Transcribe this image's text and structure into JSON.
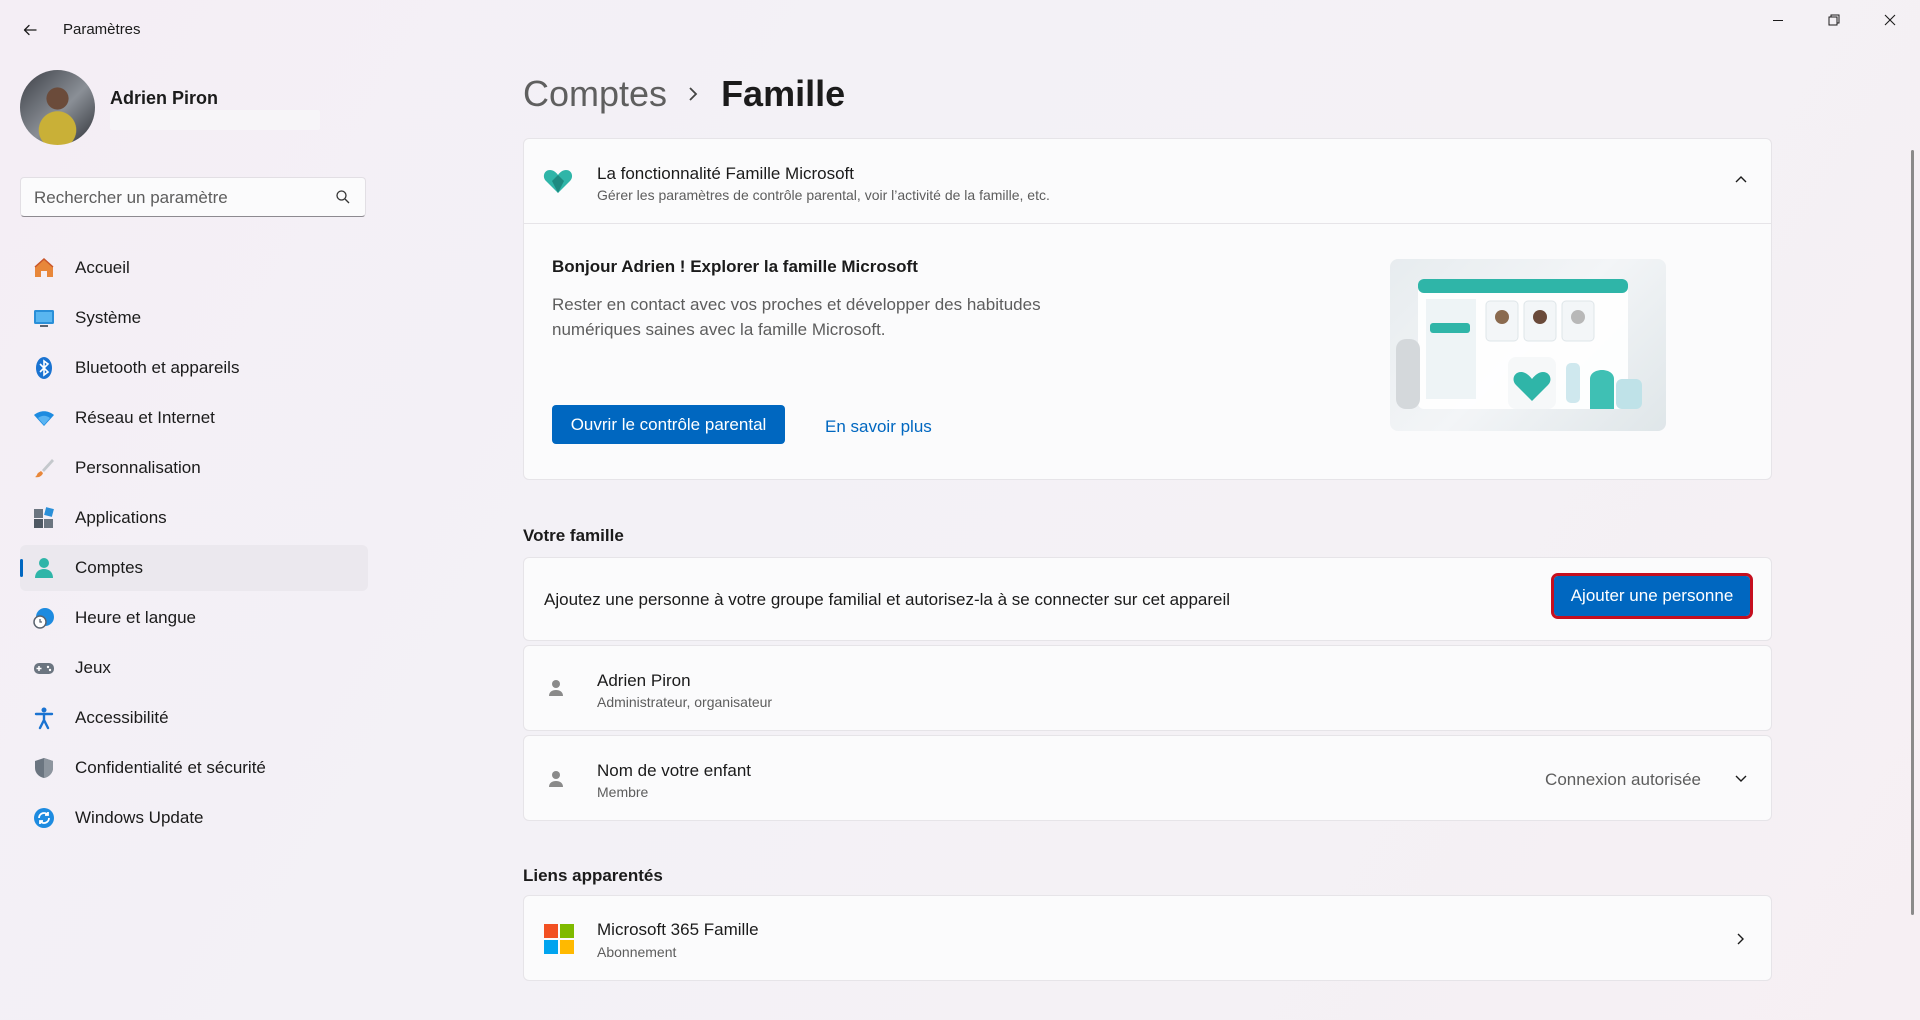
{
  "window": {
    "title": "Paramètres"
  },
  "profile": {
    "name": "Adrien Piron"
  },
  "search": {
    "placeholder": "Rechercher un paramètre"
  },
  "sidebar": {
    "items": [
      {
        "label": "Accueil",
        "icon": "home-icon"
      },
      {
        "label": "Système",
        "icon": "display-icon"
      },
      {
        "label": "Bluetooth et appareils",
        "icon": "bluetooth-icon"
      },
      {
        "label": "Réseau et Internet",
        "icon": "wifi-icon"
      },
      {
        "label": "Personnalisation",
        "icon": "brush-icon"
      },
      {
        "label": "Applications",
        "icon": "apps-icon"
      },
      {
        "label": "Comptes",
        "icon": "person-icon",
        "active": true
      },
      {
        "label": "Heure et langue",
        "icon": "globe-clock-icon"
      },
      {
        "label": "Jeux",
        "icon": "gamepad-icon"
      },
      {
        "label": "Accessibilité",
        "icon": "accessibility-icon"
      },
      {
        "label": "Confidentialité et sécurité",
        "icon": "shield-icon"
      },
      {
        "label": "Windows Update",
        "icon": "update-icon"
      }
    ]
  },
  "breadcrumb": {
    "parent": "Comptes",
    "current": "Famille"
  },
  "family_feature": {
    "title": "La fonctionnalité Famille Microsoft",
    "subtitle": "Gérer les paramètres de contrôle parental, voir l’activité de la famille, etc.",
    "hello": "Bonjour Adrien ! Explorer la famille Microsoft",
    "description": "Rester en contact avec vos proches et développer des habitudes numériques saines avec la famille Microsoft.",
    "primary_button": "Ouvrir le contrôle parental",
    "link": "En savoir plus"
  },
  "your_family": {
    "title": "Votre famille",
    "add_text": "Ajoutez une personne à votre groupe familial et autorisez-la à se connecter sur cet appareil",
    "add_button": "Ajouter une personne",
    "members": [
      {
        "name": "Adrien Piron",
        "role": "Administrateur, organisateur"
      },
      {
        "name": "Nom de votre enfant",
        "role": "Membre",
        "status": "Connexion autorisée"
      }
    ]
  },
  "related": {
    "title": "Liens apparentés",
    "items": [
      {
        "name": "Microsoft 365 Famille",
        "sub": "Abonnement"
      }
    ]
  },
  "colors": {
    "accent": "#0067c0",
    "highlight_border": "#c50f1f",
    "family_icon": "#2fb5a8"
  }
}
